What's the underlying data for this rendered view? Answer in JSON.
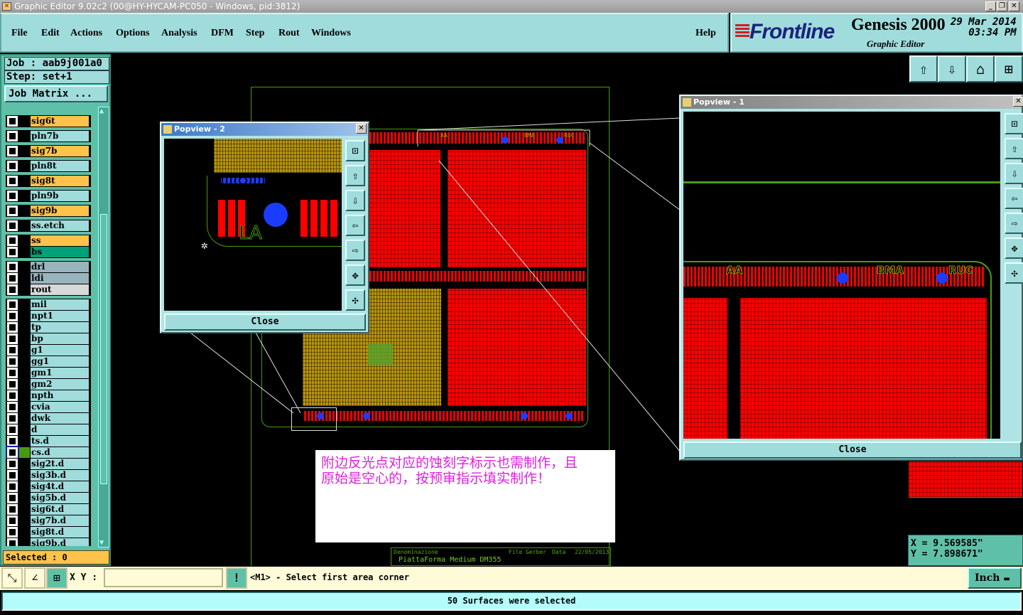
{
  "window": {
    "title": "Graphic Editor 9.02c2 (00@HY-HYCAM-PC050 - Windows, pid:3812)"
  },
  "menu": {
    "items": [
      "File",
      "Edit",
      "Actions",
      "Options",
      "Analysis",
      "DFM",
      "Step",
      "Rout",
      "Windows"
    ],
    "help": "Help"
  },
  "brand": {
    "logo": "Frontline",
    "product": "Genesis 2000",
    "subtitle": "Graphic Editor",
    "date": "29 Mar 2014",
    "time": "03:34 PM"
  },
  "job": {
    "job_line": "Job : aab9j001a0",
    "step_line": "Step: set+1",
    "job_matrix": "Job Matrix ..."
  },
  "layers": [
    {
      "name": "sig6t",
      "color": "#ffc24a"
    },
    {
      "name": "pln7b",
      "color": "#a0dcdc"
    },
    {
      "name": "sig7b",
      "color": "#ffc24a"
    },
    {
      "name": "pln8t",
      "color": "#a0dcdc"
    },
    {
      "name": "sig8t",
      "color": "#ffc24a"
    },
    {
      "name": "pln9b",
      "color": "#a0dcdc"
    },
    {
      "name": "sig9b",
      "color": "#ffc24a"
    },
    {
      "name": "ss.etch",
      "color": "#a0dcdc"
    },
    {
      "name": "ss",
      "color": "#ffc24a"
    },
    {
      "name": "bs",
      "color": "#00a078"
    },
    {
      "name": "drl",
      "color": "#9ab4be"
    },
    {
      "name": "ldi",
      "color": "#9ab4be"
    },
    {
      "name": "rout",
      "color": "#d8d8d8"
    },
    {
      "name": "mil",
      "color": "#a0dcdc"
    },
    {
      "name": "npt1",
      "color": "#a0dcdc"
    },
    {
      "name": "tp",
      "color": "#a0dcdc"
    },
    {
      "name": "bp",
      "color": "#a0dcdc"
    },
    {
      "name": "g1",
      "color": "#a0dcdc"
    },
    {
      "name": "gg1",
      "color": "#a0dcdc"
    },
    {
      "name": "gm1",
      "color": "#a0dcdc"
    },
    {
      "name": "gm2",
      "color": "#a0dcdc"
    },
    {
      "name": "npth",
      "color": "#a0dcdc"
    },
    {
      "name": "cvia",
      "color": "#a0dcdc"
    },
    {
      "name": "dwk",
      "color": "#a0dcdc"
    },
    {
      "name": "d",
      "color": "#a0dcdc"
    },
    {
      "name": "ts.d",
      "color": "#a0dcdc"
    },
    {
      "name": "cs.d",
      "color": "#a0dcdc",
      "affected": true
    },
    {
      "name": "sig2t.d",
      "color": "#a0dcdc"
    },
    {
      "name": "sig3b.d",
      "color": "#a0dcdc"
    },
    {
      "name": "sig4t.d",
      "color": "#a0dcdc"
    },
    {
      "name": "sig5b.d",
      "color": "#a0dcdc"
    },
    {
      "name": "sig6t.d",
      "color": "#a0dcdc"
    },
    {
      "name": "sig7b.d",
      "color": "#a0dcdc"
    },
    {
      "name": "sig8t.d",
      "color": "#a0dcdc"
    },
    {
      "name": "sig9b.d",
      "color": "#a0dcdc"
    }
  ],
  "selected": "Selected : 0",
  "popview2": {
    "title": "Popview - 2",
    "close": "Close",
    "label": "LA"
  },
  "popview1": {
    "title": "Popview - 1",
    "close": "Close",
    "labels": [
      "AA",
      "BMA",
      "RUC"
    ]
  },
  "board_labels": [
    "AA",
    "BMA",
    "RUC",
    "LA"
  ],
  "title_block": {
    "denominazione": "Denominazione",
    "desc": "PiattaForma Medium DM355",
    "file": "File Gerber",
    "data_label": "Data",
    "data_value": "22/05/2013"
  },
  "note": {
    "line1": "附边反光点对应的蚀刻字标示也需制作，且",
    "line2": "原始是空心的，按预审指示填实制作！"
  },
  "coords": {
    "x": "X = 9.569585\"",
    "y": "Y = 7.898671\""
  },
  "bottom": {
    "xy_label": "X Y :",
    "xy_value": "",
    "message": "<M1> - Select first area corner",
    "unit": "Inch"
  },
  "status": "50 Surfaces were selected",
  "colors": {
    "panel": "#a0dcdc",
    "copper": "#ff0000",
    "selected": "#b8940a",
    "outline": "#4a9a10"
  }
}
